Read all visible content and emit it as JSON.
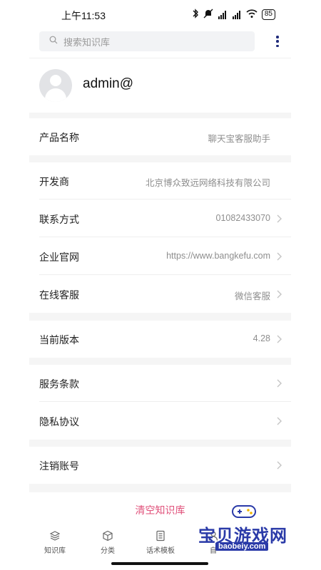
{
  "status_bar": {
    "time": "上午11:53",
    "battery": "85",
    "signal_label_1": "HD",
    "signal_label_2": "HD"
  },
  "search": {
    "placeholder": "搜索知识库"
  },
  "profile": {
    "username": "admin@"
  },
  "info_rows": [
    {
      "label": "产品名称",
      "value": "聊天宝客服助手",
      "has_arrow": false
    },
    {
      "label": "开发商",
      "value": "北京博众致远网络科技有限公司",
      "has_arrow": false
    },
    {
      "label": "联系方式",
      "value": "01082433070",
      "has_arrow": true
    },
    {
      "label": "企业官网",
      "value": "https://www.bangkefu.com",
      "has_arrow": true
    },
    {
      "label": "在线客服",
      "value": "微信客服",
      "has_arrow": true
    },
    {
      "label": "当前版本",
      "value": "4.28",
      "has_arrow": true
    },
    {
      "label": "服务条款",
      "value": "",
      "has_arrow": true
    },
    {
      "label": "隐私协议",
      "value": "",
      "has_arrow": true
    },
    {
      "label": "注销账号",
      "value": "",
      "has_arrow": true
    }
  ],
  "actions": {
    "clear_label": "清空知识库"
  },
  "tabs": [
    {
      "label": "知识库",
      "icon": "layers-icon"
    },
    {
      "label": "分类",
      "icon": "cube-icon"
    },
    {
      "label": "话术模板",
      "icon": "document-icon"
    },
    {
      "label": "自",
      "icon": "user-icon"
    }
  ],
  "watermark": {
    "text": "宝贝游戏网",
    "url": "baobeiy.com"
  },
  "colors": {
    "accent_pink": "#e0507a",
    "more_dots": "#1f2a7a",
    "watermark_blue": "#2a3aa8"
  }
}
